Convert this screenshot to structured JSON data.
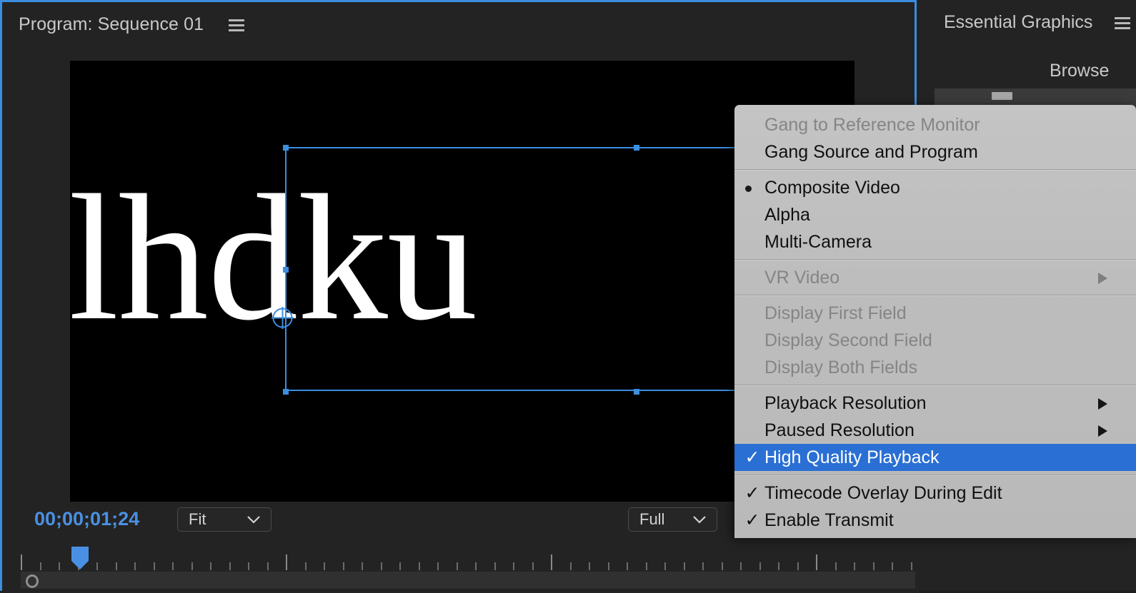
{
  "program_panel": {
    "title": "Program: Sequence 01",
    "menu_icon": "hamburger-icon",
    "video_text": "lhdku",
    "timecode": "00;00;01;24",
    "zoom_select": {
      "value": "Fit",
      "icon": "chevron-down-icon"
    },
    "resolution_select": {
      "value": "Full",
      "icon": "chevron-down-icon"
    },
    "accent_color": "#3b8ee0",
    "timecode_color": "#4a90e2"
  },
  "essential_graphics": {
    "title": "Essential Graphics",
    "menu_icon": "hamburger-icon",
    "tab_browse": "Browse"
  },
  "context_menu": {
    "highlight_color": "#2a6fd4",
    "groups": [
      {
        "items": [
          {
            "label": "Gang to Reference Monitor",
            "state": "disabled",
            "mark": "",
            "submenu": false
          },
          {
            "label": "Gang Source and Program",
            "state": "normal",
            "mark": "",
            "submenu": false
          }
        ]
      },
      {
        "items": [
          {
            "label": "Composite Video",
            "state": "normal",
            "mark": "bullet",
            "submenu": false
          },
          {
            "label": "Alpha",
            "state": "normal",
            "mark": "",
            "submenu": false
          },
          {
            "label": "Multi-Camera",
            "state": "normal",
            "mark": "",
            "submenu": false
          }
        ]
      },
      {
        "items": [
          {
            "label": "VR Video",
            "state": "disabled",
            "mark": "",
            "submenu": true
          }
        ]
      },
      {
        "items": [
          {
            "label": "Display First Field",
            "state": "disabled",
            "mark": "",
            "submenu": false
          },
          {
            "label": "Display Second Field",
            "state": "disabled",
            "mark": "",
            "submenu": false
          },
          {
            "label": "Display Both Fields",
            "state": "disabled",
            "mark": "",
            "submenu": false
          }
        ]
      },
      {
        "items": [
          {
            "label": "Playback Resolution",
            "state": "normal",
            "mark": "",
            "submenu": true
          },
          {
            "label": "Paused Resolution",
            "state": "normal",
            "mark": "",
            "submenu": true
          },
          {
            "label": "High Quality Playback",
            "state": "selected",
            "mark": "check",
            "submenu": false
          }
        ]
      },
      {
        "items": [
          {
            "label": "Timecode Overlay During Edit",
            "state": "normal",
            "mark": "check",
            "submenu": false
          },
          {
            "label": "Enable Transmit",
            "state": "normal",
            "mark": "check",
            "submenu": false
          }
        ]
      }
    ]
  }
}
